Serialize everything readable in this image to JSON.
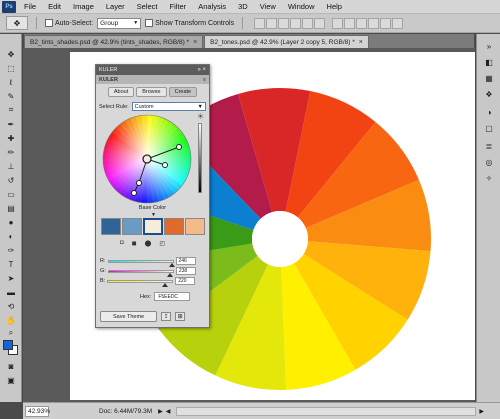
{
  "menubar": {
    "logo": "Ps",
    "items": [
      "File",
      "Edit",
      "Image",
      "Layer",
      "Select",
      "Filter",
      "Analysis",
      "3D",
      "View",
      "Window",
      "Help"
    ]
  },
  "options": {
    "auto_select_label": "Auto-Select:",
    "auto_select_value": "Group",
    "show_transform_label": "Show Transform Controls"
  },
  "tabs": [
    {
      "label": "B2_tints_shades.psd @ 42.9% (tints_shades, RGB/8) *",
      "active": false
    },
    {
      "label": "B2_tones.psd @ 42.9% (Layer 2 copy 5, RGB/8) *",
      "active": true
    }
  ],
  "kuler": {
    "title": "KULER",
    "tabs": [
      "About",
      "Browse",
      "Create"
    ],
    "active_tab": "Create",
    "select_rule_label": "Select Rule:",
    "select_rule_value": "Custom",
    "base_color_label": "Base Color",
    "swatches": [
      "#2e6496",
      "#6a9bc4",
      "#f5ecdc",
      "#de6b2c",
      "#f5ba8a"
    ],
    "sliders": [
      {
        "label": "R:",
        "value": "246",
        "fraction": 0.96
      },
      {
        "label": "G:",
        "value": "238",
        "fraction": 0.93
      },
      {
        "label": "B:",
        "value": "220",
        "fraction": 0.86
      }
    ],
    "hex_label": "Hex:",
    "hex_value": "F5EEDC",
    "save_label": "Save Theme"
  },
  "wheel_colors": [
    "#b31c4a",
    "#d92727",
    "#f24313",
    "#f86612",
    "#fb8c12",
    "#ffb10c",
    "#ffd200",
    "#fff000",
    "#e3e70a",
    "#b7d10c",
    "#7bbb1c",
    "#3a9b16",
    "#0c7fd1"
  ],
  "status": {
    "zoom": "42.93%",
    "doc_info": "Doc: 6.44M/79.3M"
  }
}
